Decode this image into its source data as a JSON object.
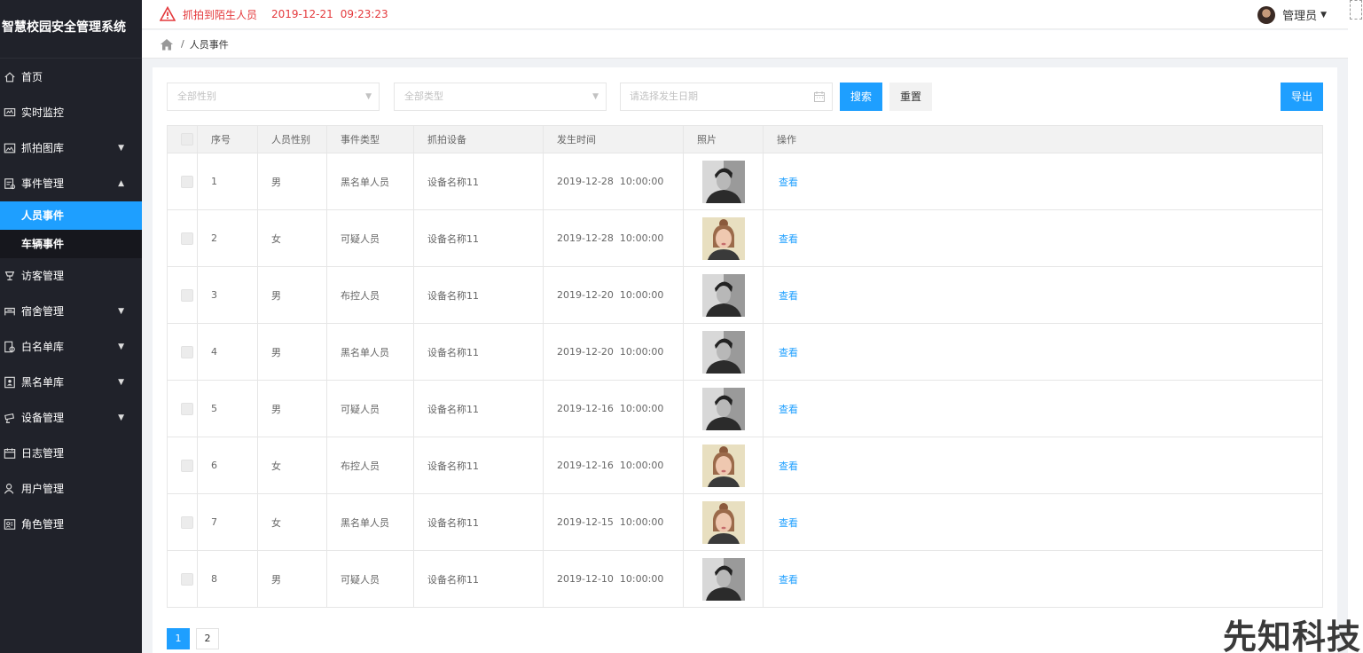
{
  "app": {
    "title": "智慧校园安全管理系统"
  },
  "alert": {
    "message": "抓拍到陌生人员",
    "date": "2019-12-21",
    "time": "09:23:23",
    "color": "#e4393c"
  },
  "user": {
    "name": "管理员"
  },
  "breadcrumb": {
    "current": "人员事件"
  },
  "sidebar": {
    "items": [
      {
        "label": "首页",
        "icon": "home-icon"
      },
      {
        "label": "实时监控",
        "icon": "monitor-icon"
      },
      {
        "label": "抓拍图库",
        "icon": "image-icon",
        "expanded": false
      },
      {
        "label": "事件管理",
        "icon": "event-icon",
        "expanded": true
      },
      {
        "label": "访客管理",
        "icon": "cup-icon"
      },
      {
        "label": "宿舍管理",
        "icon": "bed-icon",
        "expanded": false
      },
      {
        "label": "白名单库",
        "icon": "whitelist-icon",
        "expanded": false
      },
      {
        "label": "黑名单库",
        "icon": "blacklist-icon",
        "expanded": false
      },
      {
        "label": "设备管理",
        "icon": "camera-icon",
        "expanded": false
      },
      {
        "label": "日志管理",
        "icon": "calendar-icon"
      },
      {
        "label": "用户管理",
        "icon": "users-icon"
      },
      {
        "label": "角色管理",
        "icon": "role-icon"
      }
    ],
    "sub_items": [
      {
        "label": "人员事件",
        "active": true
      },
      {
        "label": "车辆事件",
        "active": false
      }
    ]
  },
  "filters": {
    "gender_placeholder": "全部性别",
    "type_placeholder": "全部类型",
    "date_placeholder": "请选择发生日期",
    "search_label": "搜索",
    "reset_label": "重置",
    "export_label": "导出"
  },
  "table": {
    "headers": [
      "序号",
      "人员性别",
      "事件类型",
      "抓拍设备",
      "发生时间",
      "照片",
      "操作"
    ],
    "rows": [
      {
        "no": "1",
        "gender": "男",
        "type": "黑名单人员",
        "device": "设备名称11",
        "time": "2019-12-28  10:00:00",
        "photo": "male",
        "action": "查看"
      },
      {
        "no": "2",
        "gender": "女",
        "type": "可疑人员",
        "device": "设备名称11",
        "time": "2019-12-28  10:00:00",
        "photo": "female",
        "action": "查看"
      },
      {
        "no": "3",
        "gender": "男",
        "type": "布控人员",
        "device": "设备名称11",
        "time": "2019-12-20  10:00:00",
        "photo": "male",
        "action": "查看"
      },
      {
        "no": "4",
        "gender": "男",
        "type": "黑名单人员",
        "device": "设备名称11",
        "time": "2019-12-20  10:00:00",
        "photo": "male",
        "action": "查看"
      },
      {
        "no": "5",
        "gender": "男",
        "type": "可疑人员",
        "device": "设备名称11",
        "time": "2019-12-16  10:00:00",
        "photo": "male",
        "action": "查看"
      },
      {
        "no": "6",
        "gender": "女",
        "type": "布控人员",
        "device": "设备名称11",
        "time": "2019-12-16  10:00:00",
        "photo": "female",
        "action": "查看"
      },
      {
        "no": "7",
        "gender": "女",
        "type": "黑名单人员",
        "device": "设备名称11",
        "time": "2019-12-15  10:00:00",
        "photo": "female",
        "action": "查看"
      },
      {
        "no": "8",
        "gender": "男",
        "type": "可疑人员",
        "device": "设备名称11",
        "time": "2019-12-10  10:00:00",
        "photo": "male",
        "action": "查看"
      }
    ]
  },
  "pagination": {
    "pages": [
      "1",
      "2"
    ],
    "current": "1"
  },
  "watermark": "先知科技",
  "colors": {
    "sidebar": "#20222a",
    "accent": "#1e9fff",
    "alert": "#e4393c"
  }
}
